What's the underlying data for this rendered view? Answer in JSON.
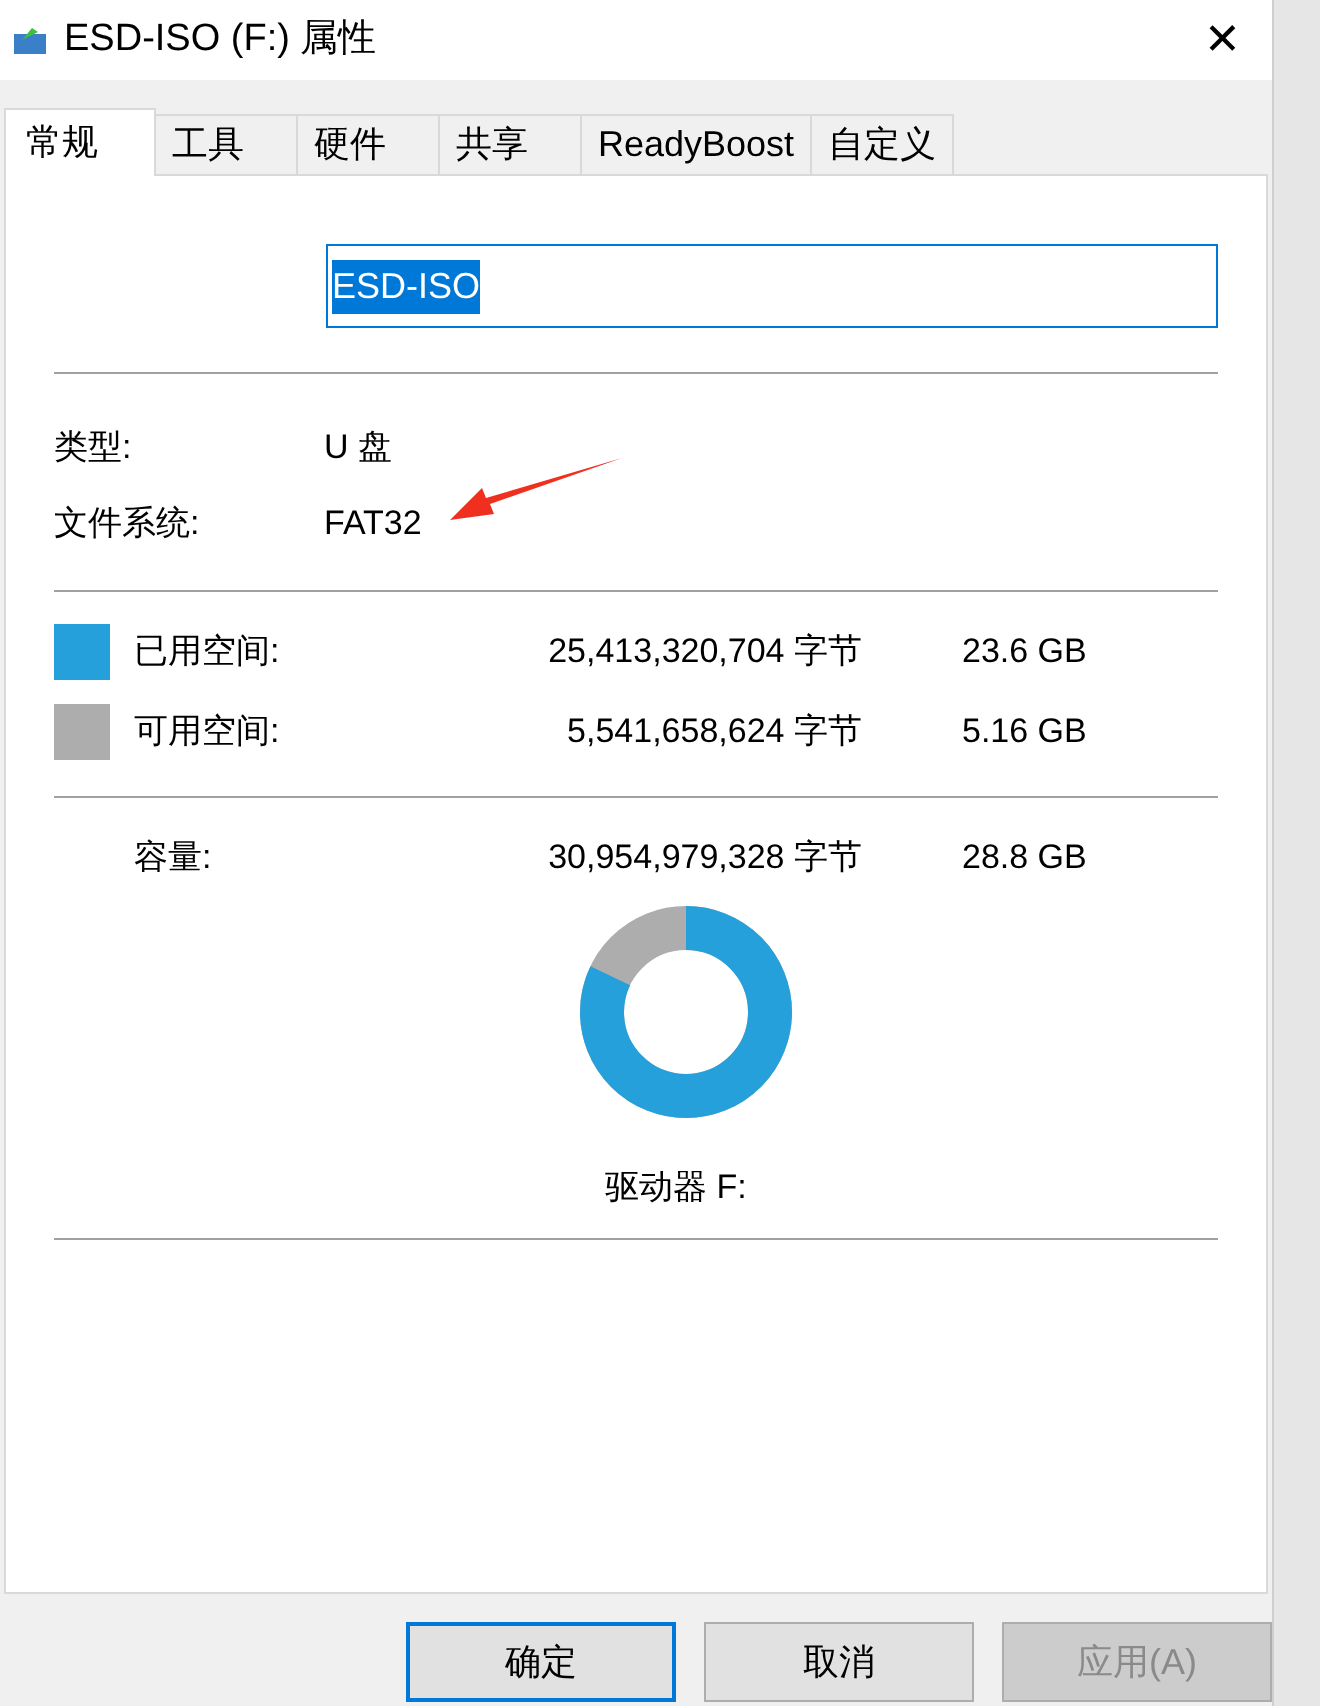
{
  "window": {
    "title": "ESD-ISO (F:) 属性",
    "close": "✕"
  },
  "tabs": [
    {
      "label": "常规",
      "selected": true
    },
    {
      "label": "工具",
      "selected": false
    },
    {
      "label": "硬件",
      "selected": false
    },
    {
      "label": "共享",
      "selected": false
    },
    {
      "label": "ReadyBoost",
      "selected": false
    },
    {
      "label": "自定义",
      "selected": false
    }
  ],
  "name_field": {
    "value": "ESD-ISO",
    "selected": true
  },
  "info": [
    {
      "label": "类型:",
      "value": "U 盘",
      "annotated": false
    },
    {
      "label": "文件系统:",
      "value": "FAT32",
      "annotated": true
    }
  ],
  "space": [
    {
      "label": "已用空间:",
      "bytes": "25,413,320,704 字节",
      "size": "23.6 GB",
      "color": "#26a0da"
    },
    {
      "label": "可用空间:",
      "bytes": "5,541,658,624 字节",
      "size": "5.16 GB",
      "color": "#adadad"
    }
  ],
  "capacity": {
    "label": "容量:",
    "bytes": "30,954,979,328 字节",
    "size": "28.8 GB",
    "level": 0.82
  },
  "drive_label": "驱动器 F:",
  "buttons": [
    {
      "label": "确定",
      "kind": "default",
      "disabled": false
    },
    {
      "label": "取消",
      "kind": "normal",
      "disabled": false
    },
    {
      "label": "应用(A)",
      "kind": "normal",
      "disabled": true
    }
  ]
}
